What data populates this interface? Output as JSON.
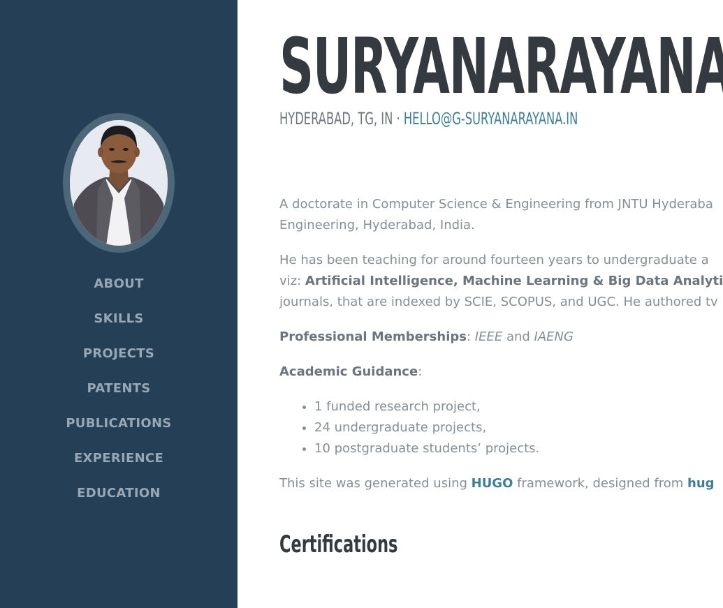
{
  "profile": {
    "name": "SURYANARAYANA",
    "location": "HYDERABAD, TG, IN",
    "separator": "·",
    "email": "HELLO@G-SURYANARAYANA.IN"
  },
  "sidebar": {
    "nav": [
      {
        "label": "ABOUT"
      },
      {
        "label": "SKILLS"
      },
      {
        "label": "PROJECTS"
      },
      {
        "label": "PATENTS"
      },
      {
        "label": "PUBLICATIONS"
      },
      {
        "label": "EXPERIENCE"
      },
      {
        "label": "EDUCATION"
      }
    ]
  },
  "about": {
    "para1_line1": "A doctorate in Computer Science & Engineering from JNTU Hyderaba",
    "para1_line2": "Engineering, Hyderabad, India.",
    "para2_line1": "He has been teaching for around fourteen years to undergraduate a",
    "para2_line2_prefix": "viz: ",
    "para2_line2_bold": "Artificial Intelligence, Machine Learning & Big Data Analytics",
    "para2_line3": "journals, that are indexed by SCIE, SCOPUS, and UGC. He authored tv",
    "memberships_label": "Professional Memberships",
    "memberships_colon": ": ",
    "membership_1": "IEEE",
    "memberships_and": " and ",
    "membership_2": "IAENG",
    "guidance_label": "Academic Guidance",
    "guidance_colon": ":",
    "guidance_items": [
      "1 funded research project,",
      "24 undergraduate projects,",
      "10 postgraduate students’ projects."
    ],
    "site_prefix": "This site was generated using ",
    "site_link_hugo": "HUGO",
    "site_middle": " framework, designed from ",
    "site_link_theme": "hug"
  },
  "certifications": {
    "title": "Certifications"
  },
  "colors": {
    "sidebar_bg": "#243f56",
    "accent": "#3f7e93",
    "heading": "#343a40",
    "body_text": "#868e96",
    "nav_text": "#97a7b5"
  }
}
